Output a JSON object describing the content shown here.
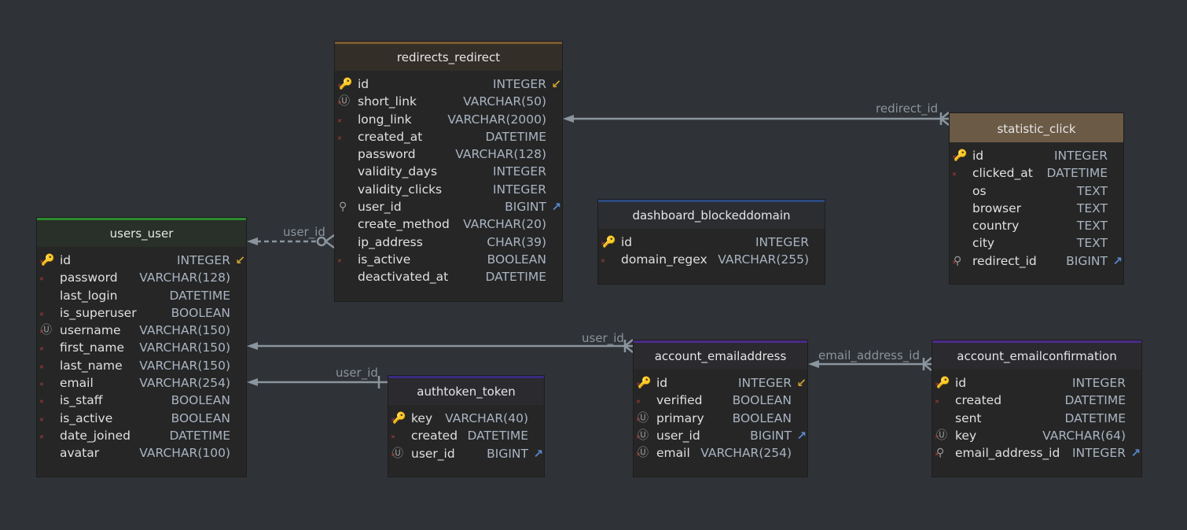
{
  "colors": {
    "background": "#2f3237",
    "edge": "#8a959e"
  },
  "tables": [
    {
      "id": "redirects_redirect",
      "title": "redirects_redirect",
      "header_bg": "#342e29",
      "accent": "#7a5a30",
      "columns": [
        {
          "name": "id",
          "type": "INTEGER",
          "flag": true,
          "icon": "key",
          "ref": "pk"
        },
        {
          "name": "short_link",
          "type": "VARCHAR(50)",
          "flag": true,
          "icon": "unique"
        },
        {
          "name": "long_link",
          "type": "VARCHAR(2000)",
          "flag": true
        },
        {
          "name": "created_at",
          "type": "DATETIME",
          "flag": true
        },
        {
          "name": "password",
          "type": "VARCHAR(128)"
        },
        {
          "name": "validity_days",
          "type": "INTEGER"
        },
        {
          "name": "validity_clicks",
          "type": "INTEGER"
        },
        {
          "name": "user_id",
          "type": "BIGINT",
          "icon": "index",
          "ref": "fk"
        },
        {
          "name": "create_method",
          "type": "VARCHAR(20)"
        },
        {
          "name": "ip_address",
          "type": "CHAR(39)"
        },
        {
          "name": "is_active",
          "type": "BOOLEAN",
          "flag": true
        },
        {
          "name": "deactivated_at",
          "type": "DATETIME"
        }
      ]
    },
    {
      "id": "users_user",
      "title": "users_user",
      "header_bg": "#283029",
      "accent": "#2e8b2e",
      "columns": [
        {
          "name": "id",
          "type": "INTEGER",
          "flag": true,
          "icon": "key",
          "ref": "pk"
        },
        {
          "name": "password",
          "type": "VARCHAR(128)",
          "flag": true
        },
        {
          "name": "last_login",
          "type": "DATETIME"
        },
        {
          "name": "is_superuser",
          "type": "BOOLEAN",
          "flag": true
        },
        {
          "name": "username",
          "type": "VARCHAR(150)",
          "flag": true,
          "icon": "unique"
        },
        {
          "name": "first_name",
          "type": "VARCHAR(150)",
          "flag": true
        },
        {
          "name": "last_name",
          "type": "VARCHAR(150)",
          "flag": true
        },
        {
          "name": "email",
          "type": "VARCHAR(254)",
          "flag": true
        },
        {
          "name": "is_staff",
          "type": "BOOLEAN",
          "flag": true
        },
        {
          "name": "is_active",
          "type": "BOOLEAN",
          "flag": true
        },
        {
          "name": "date_joined",
          "type": "DATETIME",
          "flag": true
        },
        {
          "name": "avatar",
          "type": "VARCHAR(100)"
        }
      ]
    },
    {
      "id": "statistic_click",
      "title": "statistic_click",
      "header_bg": "#6b5a45",
      "accent": "#6b5a45",
      "columns": [
        {
          "name": "id",
          "type": "INTEGER",
          "flag": true,
          "icon": "key"
        },
        {
          "name": "clicked_at",
          "type": "DATETIME",
          "flag": true
        },
        {
          "name": "os",
          "type": "TEXT"
        },
        {
          "name": "browser",
          "type": "TEXT"
        },
        {
          "name": "country",
          "type": "TEXT"
        },
        {
          "name": "city",
          "type": "TEXT"
        },
        {
          "name": "redirect_id",
          "type": "BIGINT",
          "flag": true,
          "icon": "index",
          "ref": "fk"
        }
      ]
    },
    {
      "id": "dashboard_blockeddomain",
      "title": "dashboard_blockeddomain",
      "header_bg": "#2b2d31",
      "accent": "#2a4a80",
      "columns": [
        {
          "name": "id",
          "type": "INTEGER",
          "flag": true,
          "icon": "key"
        },
        {
          "name": "domain_regex",
          "type": "VARCHAR(255)",
          "flag": true
        }
      ]
    },
    {
      "id": "authtoken_token",
      "title": "authtoken_token",
      "header_bg": "#2a2a2f",
      "accent": "#3a2a80",
      "columns": [
        {
          "name": "key",
          "type": "VARCHAR(40)",
          "flag": true,
          "icon": "key"
        },
        {
          "name": "created",
          "type": "DATETIME",
          "flag": true
        },
        {
          "name": "user_id",
          "type": "BIGINT",
          "flag": true,
          "icon": "unique",
          "ref": "fk"
        }
      ]
    },
    {
      "id": "account_emailaddress",
      "title": "account_emailaddress",
      "header_bg": "#2a2a2f",
      "accent": "#4a2a8a",
      "columns": [
        {
          "name": "id",
          "type": "INTEGER",
          "flag": true,
          "icon": "key",
          "ref": "pk"
        },
        {
          "name": "verified",
          "type": "BOOLEAN",
          "flag": true
        },
        {
          "name": "primary",
          "type": "BOOLEAN",
          "flag": true,
          "icon": "unique"
        },
        {
          "name": "user_id",
          "type": "BIGINT",
          "flag": true,
          "icon": "unique",
          "ref": "fk"
        },
        {
          "name": "email",
          "type": "VARCHAR(254)",
          "flag": true,
          "icon": "unique"
        }
      ]
    },
    {
      "id": "account_emailconfirmation",
      "title": "account_emailconfirmation",
      "header_bg": "#2a2a2f",
      "accent": "#4a2a8a",
      "columns": [
        {
          "name": "id",
          "type": "INTEGER",
          "flag": true,
          "icon": "key"
        },
        {
          "name": "created",
          "type": "DATETIME",
          "flag": true
        },
        {
          "name": "sent",
          "type": "DATETIME"
        },
        {
          "name": "key",
          "type": "VARCHAR(64)",
          "flag": true,
          "icon": "unique"
        },
        {
          "name": "email_address_id",
          "type": "INTEGER",
          "flag": true,
          "icon": "index",
          "ref": "fk"
        }
      ]
    }
  ],
  "relations": [
    {
      "label": "redirect_id",
      "from": "statistic_click",
      "to": "redirects_redirect",
      "style": "solid"
    },
    {
      "label": "user_id",
      "from": "redirects_redirect",
      "to": "users_user",
      "style": "dashed"
    },
    {
      "label": "user_id",
      "from": "account_emailaddress",
      "to": "users_user",
      "style": "solid"
    },
    {
      "label": "user_id",
      "from": "authtoken_token",
      "to": "users_user",
      "style": "solid"
    },
    {
      "label": "email_address_id",
      "from": "account_emailconfirmation",
      "to": "account_emailaddress",
      "style": "solid"
    }
  ]
}
